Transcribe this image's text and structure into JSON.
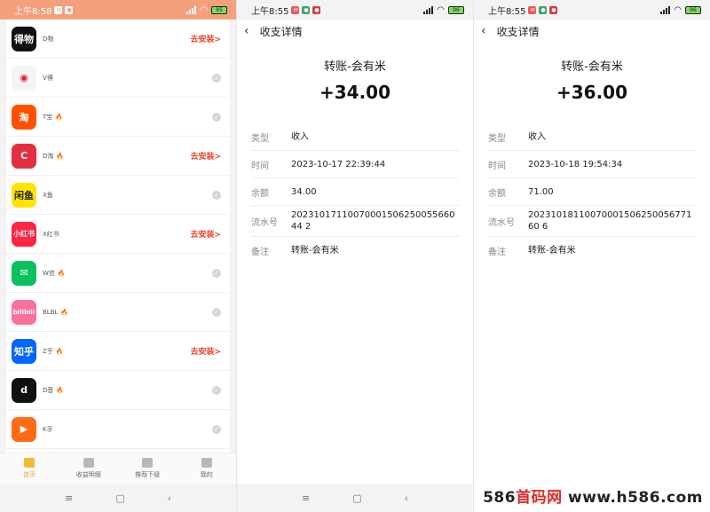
{
  "screen1": {
    "status_time": "上午8:58",
    "battery": "95",
    "apps": [
      {
        "name": "D物",
        "icon_text": "得物",
        "icon_bg": "#111111",
        "hot": false,
        "action": "install"
      },
      {
        "name": "V博",
        "icon_text": "◉",
        "icon_bg": "#f5f5f5",
        "icon_fg": "#e6162d",
        "hot": false,
        "action": "check"
      },
      {
        "name": "T宝",
        "icon_text": "淘",
        "icon_bg": "#ff5000",
        "hot": true,
        "action": "check"
      },
      {
        "name": "D淘",
        "icon_text": "C",
        "icon_bg": "#e52e40",
        "hot": true,
        "action": "install"
      },
      {
        "name": "X鱼",
        "icon_text": "闲鱼",
        "icon_bg": "#ffe400",
        "icon_fg": "#222222",
        "hot": false,
        "action": "check"
      },
      {
        "name": "X红书",
        "icon_text": "小红书",
        "icon_bg": "#ff2442",
        "hot": false,
        "action": "install"
      },
      {
        "name": "W信",
        "icon_text": "✉",
        "icon_bg": "#07c160",
        "hot": true,
        "action": "check"
      },
      {
        "name": "BLBL",
        "icon_text": "bilibili",
        "icon_bg": "#fb7299",
        "hot": true,
        "action": "check"
      },
      {
        "name": "Z乎",
        "icon_text": "知乎",
        "icon_bg": "#0066ff",
        "hot": true,
        "action": "install"
      },
      {
        "name": "D音",
        "icon_text": "d",
        "icon_bg": "#111111",
        "hot": true,
        "action": "check"
      },
      {
        "name": "K手",
        "icon_text": "▶",
        "icon_bg": "#ff6a14",
        "hot": false,
        "action": "check"
      },
      {
        "name": "",
        "icon_text": "",
        "icon_bg": "#ff2a2a",
        "hot": false,
        "action": "none"
      }
    ],
    "install_label": "去安装>",
    "tabs": [
      {
        "label": "首页",
        "active": true
      },
      {
        "label": "收益明细",
        "active": false
      },
      {
        "label": "推荐下级",
        "active": false
      },
      {
        "label": "我的",
        "active": false
      }
    ]
  },
  "screen2": {
    "status_time": "上午8:55",
    "battery": "96",
    "header_title": "收支详情",
    "pay_title": "转账-会有米",
    "amount": "+34.00",
    "rows": [
      {
        "label": "类型",
        "value": "收入"
      },
      {
        "label": "时间",
        "value": "2023-10-17 22:39:44"
      },
      {
        "label": "余额",
        "value": "34.00"
      },
      {
        "label": "流水号",
        "value": "2023101711007000150625005566044 2"
      },
      {
        "label": "备注",
        "value": "转账-会有米"
      }
    ]
  },
  "screen3": {
    "status_time": "上午8:55",
    "battery": "96",
    "header_title": "收支详情",
    "pay_title": "转账-会有米",
    "amount": "+36.00",
    "rows": [
      {
        "label": "类型",
        "value": "收入"
      },
      {
        "label": "时间",
        "value": "2023-10-18 19:54:34"
      },
      {
        "label": "余额",
        "value": "71.00"
      },
      {
        "label": "流水号",
        "value": "2023101811007000150625005677160 6"
      },
      {
        "label": "备注",
        "value": "转账-会有米"
      }
    ]
  },
  "navbar": {
    "menu_icon": "≡",
    "home_icon": "▢",
    "back_icon": "‹"
  },
  "watermark": {
    "brand_prefix": "586",
    "brand_mid": "首码网",
    "brand_url": " www.h586.com"
  }
}
